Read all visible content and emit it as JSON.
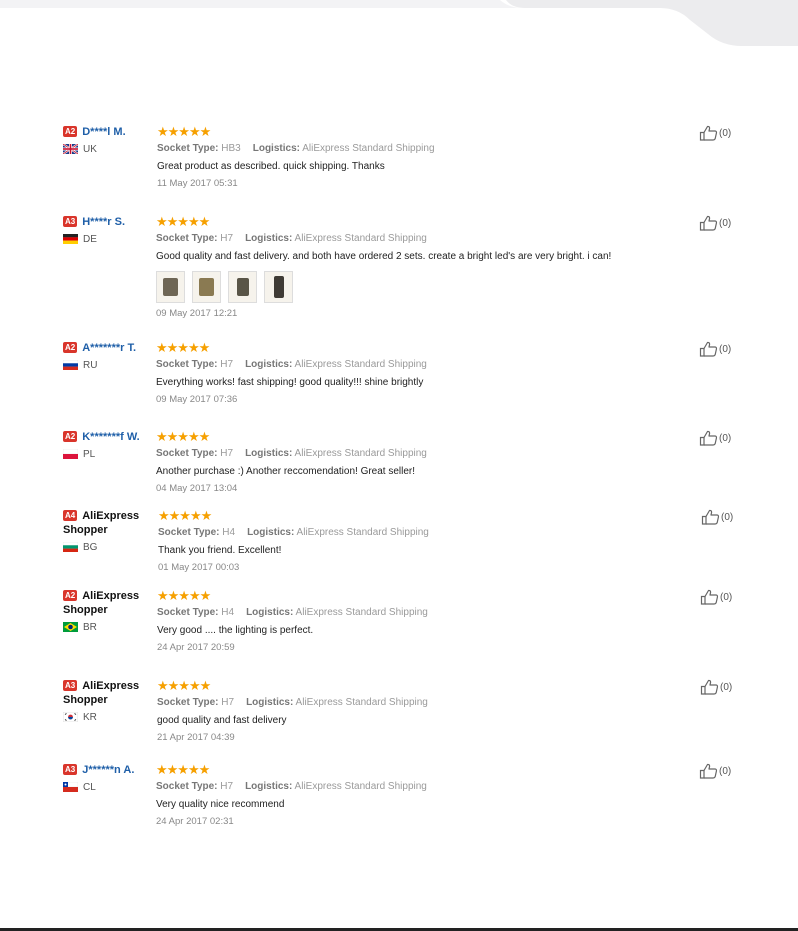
{
  "labels": {
    "socket": "Socket Type:",
    "logistics": "Logistics:"
  },
  "colors": {
    "stars": "#f6a000",
    "level_badge": "#d9352b",
    "username": "#1f5fa8"
  },
  "reviews": [
    {
      "level": "A2",
      "name_lines": [
        "D****l M."
      ],
      "country": "UK",
      "flag": "uk-flag-icon",
      "stars": "★★★★★",
      "socket": "HB3",
      "logistics": "AliExpress Standard Shipping",
      "text": "Great product as described. quick shipping. Thanks",
      "date": "11 May 2017 05:31",
      "helpful": "(0)",
      "photos": []
    },
    {
      "level": "A3",
      "name_lines": [
        "H****r S."
      ],
      "country": "DE",
      "flag": "de-flag-icon",
      "stars": "★★★★★",
      "socket": "H7",
      "logistics": "AliExpress Standard Shipping",
      "text": "Good quality and fast delivery. and both have ordered 2 sets. create a bright led's are very bright. i can!",
      "date": "09 May 2017 12:21",
      "helpful": "(0)",
      "photos": [
        "review-photo",
        "review-photo",
        "review-photo",
        "review-photo"
      ]
    },
    {
      "level": "A2",
      "name_lines": [
        "A*******r T."
      ],
      "country": "RU",
      "flag": "ru-flag-icon",
      "stars": "★★★★★",
      "socket": "H7",
      "logistics": "AliExpress Standard Shipping",
      "text": "Everything works! fast shipping! good quality!!! shine brightly",
      "date": "09 May 2017 07:36",
      "helpful": "(0)",
      "photos": []
    },
    {
      "level": "A2",
      "name_lines": [
        "K*******f W."
      ],
      "country": "PL",
      "flag": "pl-flag-icon",
      "stars": "★★★★★",
      "socket": "H7",
      "logistics": "AliExpress Standard Shipping",
      "text": "Another purchase :) Another reccomendation! Great seller!",
      "date": "04 May 2017 13:04",
      "helpful": "(0)",
      "photos": []
    },
    {
      "level": "A4",
      "name_lines": [
        "AliExpress",
        "Shopper"
      ],
      "country": "BG",
      "flag": "bg-flag-icon",
      "stars": "★★★★★",
      "socket": "H4",
      "logistics": "AliExpress Standard Shipping",
      "text": "Thank you friend. Excellent!",
      "date": "01 May 2017 00:03",
      "helpful": "(0)",
      "photos": []
    },
    {
      "level": "A2",
      "name_lines": [
        "AliExpress",
        "Shopper"
      ],
      "country": "BR",
      "flag": "br-flag-icon",
      "stars": "★★★★★",
      "socket": "H4",
      "logistics": "AliExpress Standard Shipping",
      "text": "Very good .... the lighting is perfect.",
      "date": "24 Apr 2017 20:59",
      "helpful": "(0)",
      "photos": []
    },
    {
      "level": "A3",
      "name_lines": [
        "AliExpress",
        "Shopper"
      ],
      "country": "KR",
      "flag": "kr-flag-icon",
      "stars": "★★★★★",
      "socket": "H7",
      "logistics": "AliExpress Standard Shipping",
      "text": "good quality and fast delivery",
      "date": "21 Apr 2017 04:39",
      "helpful": "(0)",
      "photos": []
    },
    {
      "level": "A3",
      "name_lines": [
        "J******n A."
      ],
      "country": "CL",
      "flag": "cl-flag-icon",
      "stars": "★★★★★",
      "socket": "H7",
      "logistics": "AliExpress Standard Shipping",
      "text": "Very quality nice recommend",
      "date": "24 Apr 2017 02:31",
      "helpful": "(0)",
      "photos": []
    }
  ]
}
